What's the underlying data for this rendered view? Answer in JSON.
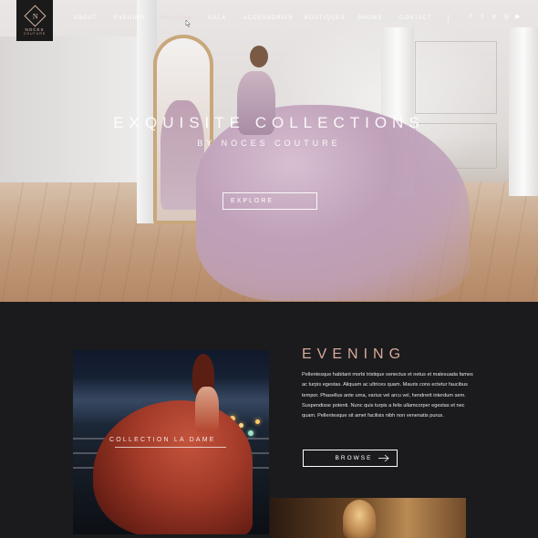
{
  "brand": {
    "initial": "N",
    "name": "NOCES",
    "tagline": "COUTURE"
  },
  "nav": {
    "items": [
      {
        "label": "ABOUT"
      },
      {
        "label": "EVENING"
      },
      {
        "label": "WEDDING"
      },
      {
        "label": "GALA"
      },
      {
        "label": "ACCESSORIES"
      },
      {
        "label": "BOUTIQUES"
      },
      {
        "label": "SHOWS"
      },
      {
        "label": "CONTACT"
      }
    ],
    "active": "WEDDING",
    "social": [
      {
        "icon": "facebook-icon",
        "glyph": "f"
      },
      {
        "icon": "twitter-icon",
        "glyph": "t"
      },
      {
        "icon": "pinterest-icon",
        "glyph": "p"
      },
      {
        "icon": "instagram-icon",
        "glyph": "◎"
      },
      {
        "icon": "youtube-icon",
        "glyph": "▶"
      }
    ]
  },
  "hero": {
    "title": "EXQUISITE COLLECTIONS",
    "subtitle": "BY NOCES COUTURE",
    "button": "EXPLORE"
  },
  "evening": {
    "title": "EVENING",
    "text": "Pellentesque habitant morbi tristique senectus et netus et malesuada fames ac turpis egestas. Aliquam ac ultrices quam. Mauris cons ectetur faucibus tempor. Phasellus ante urna, varius vel arcu vel, hendrerit interdum sem. Suspendisse potenti. Nunc quis turpis a felis ullamcorper egestas et nec quam. Pellentesque sit amet facilisis nibh non venenatis purus.",
    "button": "BROWSE",
    "image_label": "COLLECTION LA DAME"
  },
  "colors": {
    "accent": "#d8a99b",
    "dark_bg": "#1b1b1d"
  }
}
